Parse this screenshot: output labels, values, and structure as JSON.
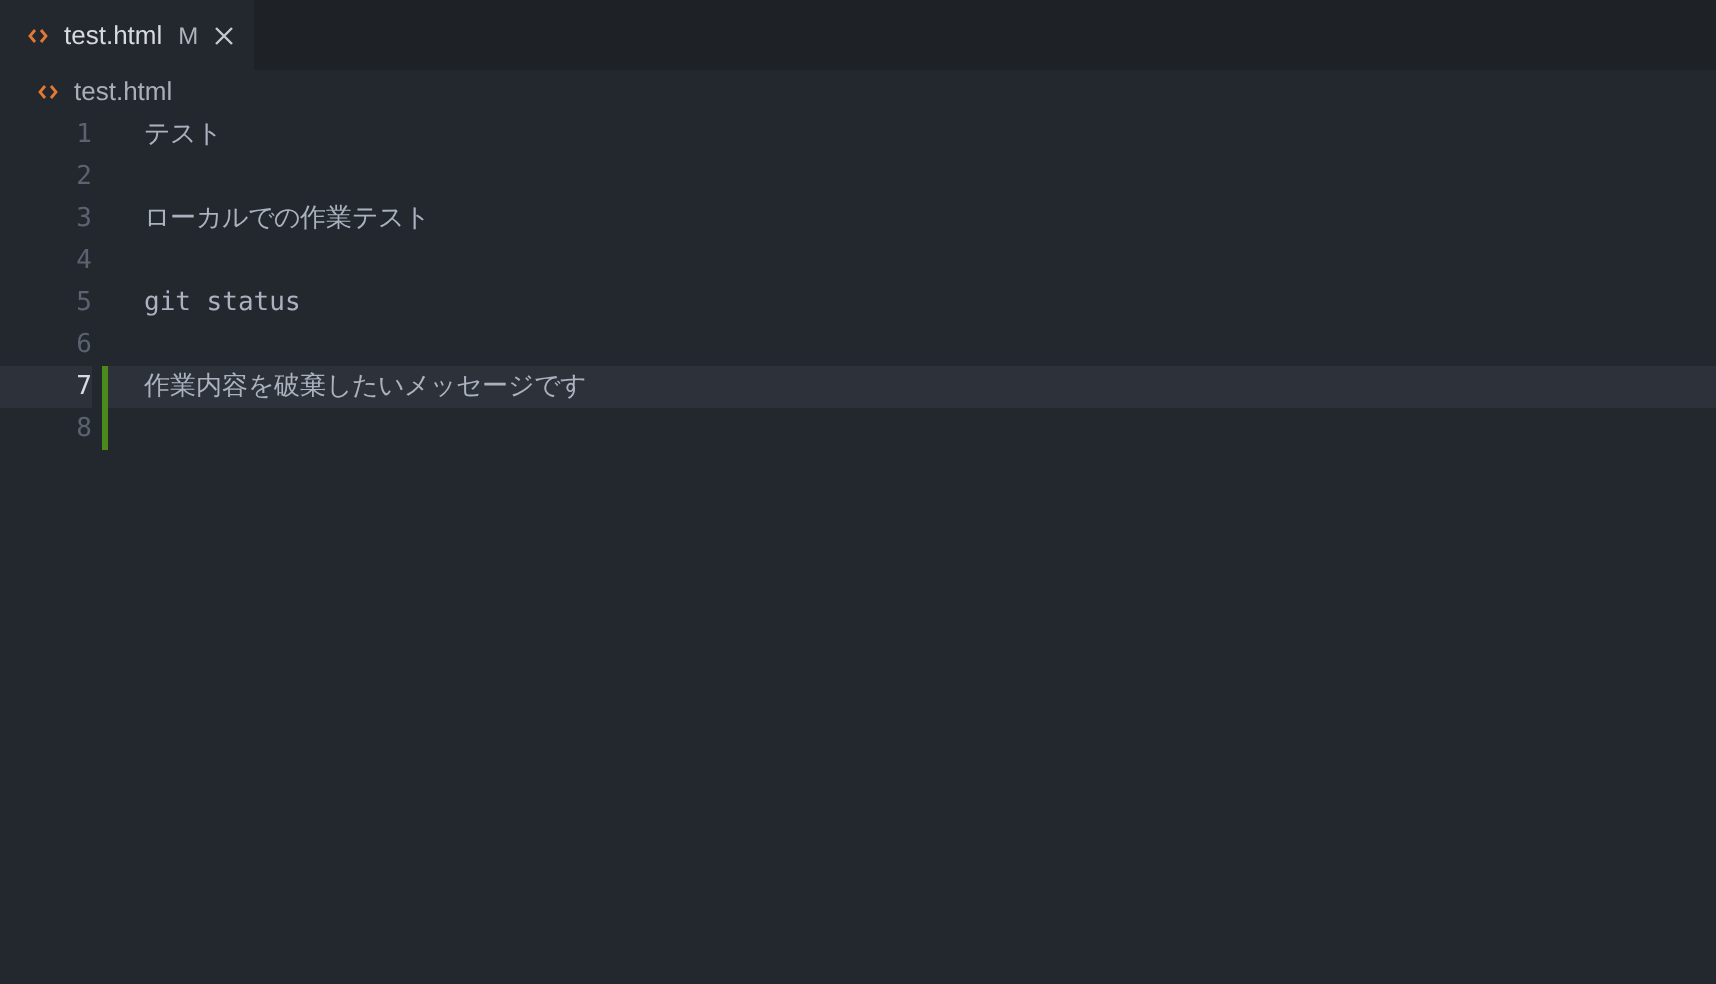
{
  "tabs": [
    {
      "label": "test.html",
      "status": "M",
      "selected": true
    }
  ],
  "breadcrumb": "test.html",
  "lines": [
    {
      "number": "1",
      "text": "テスト",
      "current": false,
      "added": false
    },
    {
      "number": "2",
      "current": false,
      "added": false
    },
    {
      "number": "3",
      "text": "ローカルでの作業テスト",
      "current": false,
      "added": false
    },
    {
      "number": "4",
      "current": false,
      "added": false
    },
    {
      "number": "5",
      "text": "git status",
      "current": false,
      "added": false
    },
    {
      "number": "6",
      "current": false,
      "added": false
    },
    {
      "number": "7",
      "text": "作業内容を破棄したいメッセージです",
      "current": true,
      "added": true
    },
    {
      "number": "8",
      "current": false,
      "added": true
    }
  ]
}
